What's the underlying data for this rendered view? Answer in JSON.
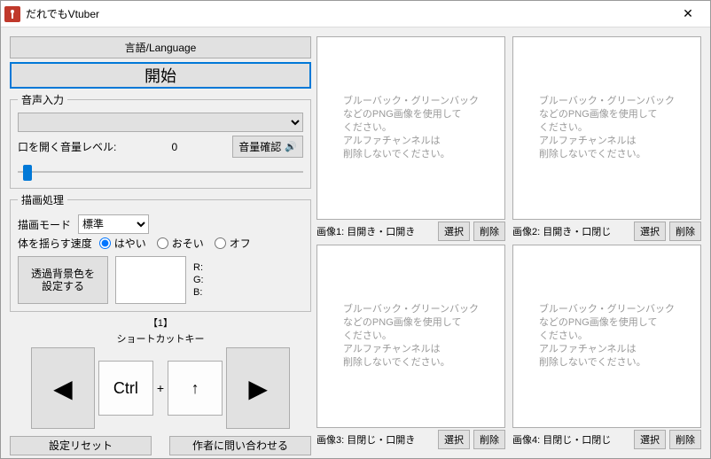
{
  "window": {
    "title": "だれでもVtuber",
    "close": "✕"
  },
  "left": {
    "language_btn": "言語/Language",
    "start_btn": "開始",
    "audio": {
      "legend": "音声入力",
      "open_level_label": "口を開く音量レベル:",
      "open_level_value": "0",
      "vol_check_btn": "音量確認"
    },
    "draw": {
      "legend": "描画処理",
      "mode_label": "描画モード",
      "mode_value": "標準",
      "sway_label": "体を揺らす速度",
      "sway_options": {
        "fast": "はやい",
        "slow": "おそい",
        "off": "オフ"
      },
      "bg_btn": "透過背景色を\n設定する",
      "rgb": {
        "r": "R:",
        "g": "G:",
        "b": "B:"
      }
    },
    "shortcut": {
      "index": "【1】",
      "label": "ショートカットキー",
      "prev": "◀",
      "next": "▶",
      "key1": "Ctrl",
      "plus": "+",
      "key2": "↑"
    },
    "reset_btn": "設定リセット",
    "contact_btn": "作者に問い合わせる"
  },
  "placeholder_text": "ブルーバック・グリーンバック\nなどのPNG画像を使用して\nください。\nアルファチャンネルは\n削除しないでください。",
  "images": {
    "select_btn": "選択",
    "delete_btn": "削除",
    "slots": [
      {
        "label": "画像1: 目開き・口開き"
      },
      {
        "label": "画像2: 目開き・口閉じ"
      },
      {
        "label": "画像3: 目閉じ・口開き"
      },
      {
        "label": "画像4: 目閉じ・口閉じ"
      }
    ]
  }
}
